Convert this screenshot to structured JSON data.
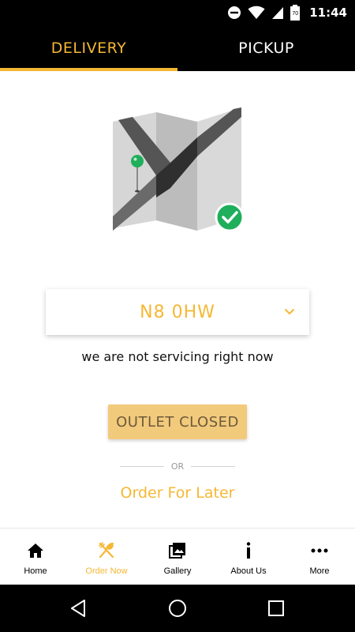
{
  "status_bar": {
    "time": "11:44",
    "battery_level": "70"
  },
  "tabs": [
    {
      "label": "DELIVERY",
      "active": true
    },
    {
      "label": "PICKUP",
      "active": false
    }
  ],
  "postcode": {
    "value": "N8 0HW"
  },
  "service_message": "we are not servicing right now",
  "outlet_button": {
    "label": "OUTLET CLOSED"
  },
  "separator": {
    "label": "OR"
  },
  "order_later": {
    "label": "Order For Later"
  },
  "bottom_nav": {
    "items": [
      {
        "label": "Home",
        "icon": "home-icon",
        "active": false
      },
      {
        "label": "Order Now",
        "icon": "fork-knife-icon",
        "active": true
      },
      {
        "label": "Gallery",
        "icon": "gallery-icon",
        "active": false
      },
      {
        "label": "About Us",
        "icon": "info-icon",
        "active": false
      },
      {
        "label": "More",
        "icon": "more-dots-icon",
        "active": false
      }
    ]
  },
  "colors": {
    "accent": "#f5b834",
    "button_disabled": "#f2ca7c",
    "success_green": "#1fae5b"
  }
}
